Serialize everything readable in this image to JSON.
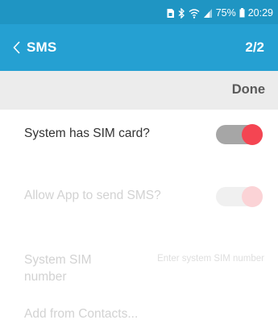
{
  "status_bar": {
    "battery": "75%",
    "time": "20:29",
    "icons": [
      "sim-card-icon",
      "bluetooth-icon",
      "wifi-icon",
      "signal-icon",
      "battery-icon"
    ]
  },
  "header": {
    "title": "SMS",
    "page_indicator": "2/2",
    "back_icon": "chevron-left-icon"
  },
  "action_bar": {
    "done_label": "Done"
  },
  "settings": {
    "sim_card": {
      "label": "System has SIM card?",
      "enabled": true,
      "checked": true
    },
    "allow_sms": {
      "label": "Allow App to send SMS?",
      "enabled": false,
      "checked": true
    }
  },
  "sim_number": {
    "label": "System SIM number",
    "value": "",
    "placeholder": "Enter system SIM number",
    "contacts_link": "Add from Contacts..."
  },
  "colors": {
    "status_bar": "#1f95c3",
    "app_bar": "#25a0d2",
    "action_bar": "#ececec",
    "toggle_thumb_on": "#f44552",
    "toggle_track_on": "#a6a6a6",
    "disabled_text": "#d2d2d2"
  }
}
